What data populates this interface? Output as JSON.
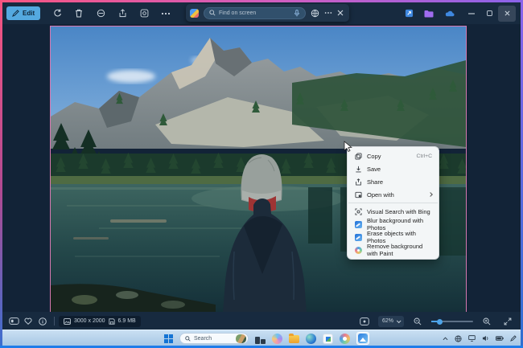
{
  "colors": {
    "accent_blue": "#54a9e0",
    "photo_border": "#d678b0",
    "menu_background": "#f3f6f7",
    "taskbar_active_blue": "#1574d4",
    "edge_glow_pink": "#f75581",
    "edge_glow_purple": "#8a63ea"
  },
  "icons": {
    "titlebar": [
      "edit-pencil",
      "rotate",
      "delete-trash",
      "hide-slash-circle",
      "share",
      "lens-frame",
      "more-ellipsis"
    ],
    "find_bar": [
      "screen-search-logo",
      "magnifier",
      "microphone",
      "web-globe",
      "more-ellipsis",
      "close-x"
    ],
    "window_controls": [
      "minimize",
      "maximize",
      "close"
    ],
    "status_bar": [
      "filmstrip",
      "heart",
      "info",
      "picture",
      "floppy",
      "fit-screen",
      "zoom-out",
      "zoom-in",
      "fullscreen"
    ],
    "taskbar": [
      "windows-start",
      "magnifier",
      "task-view",
      "copilot",
      "file-explorer",
      "edge",
      "store",
      "paint",
      "photos-active",
      "chevron-up",
      "network-globe",
      "display",
      "speaker",
      "battery",
      "pen"
    ]
  },
  "titlebar": {
    "edit_label": "Edit"
  },
  "find_bar": {
    "placeholder": "Find on screen"
  },
  "context_menu": {
    "items": [
      {
        "label": "Copy",
        "shortcut": "Ctrl+C"
      },
      {
        "label": "Save",
        "shortcut": ""
      },
      {
        "label": "Share",
        "shortcut": ""
      },
      {
        "label": "Open with",
        "shortcut": ""
      },
      {
        "label": "Visual Search with Bing",
        "shortcut": ""
      },
      {
        "label": "Blur background with Photos",
        "shortcut": ""
      },
      {
        "label": "Erase objects with Photos",
        "shortcut": ""
      },
      {
        "label": "Remove background with Paint",
        "shortcut": ""
      }
    ]
  },
  "status_bar": {
    "dimensions": "3000 x 2000",
    "file_size": "6.9 MB",
    "zoom_level": "62%"
  },
  "taskbar": {
    "search_placeholder": "Search"
  }
}
